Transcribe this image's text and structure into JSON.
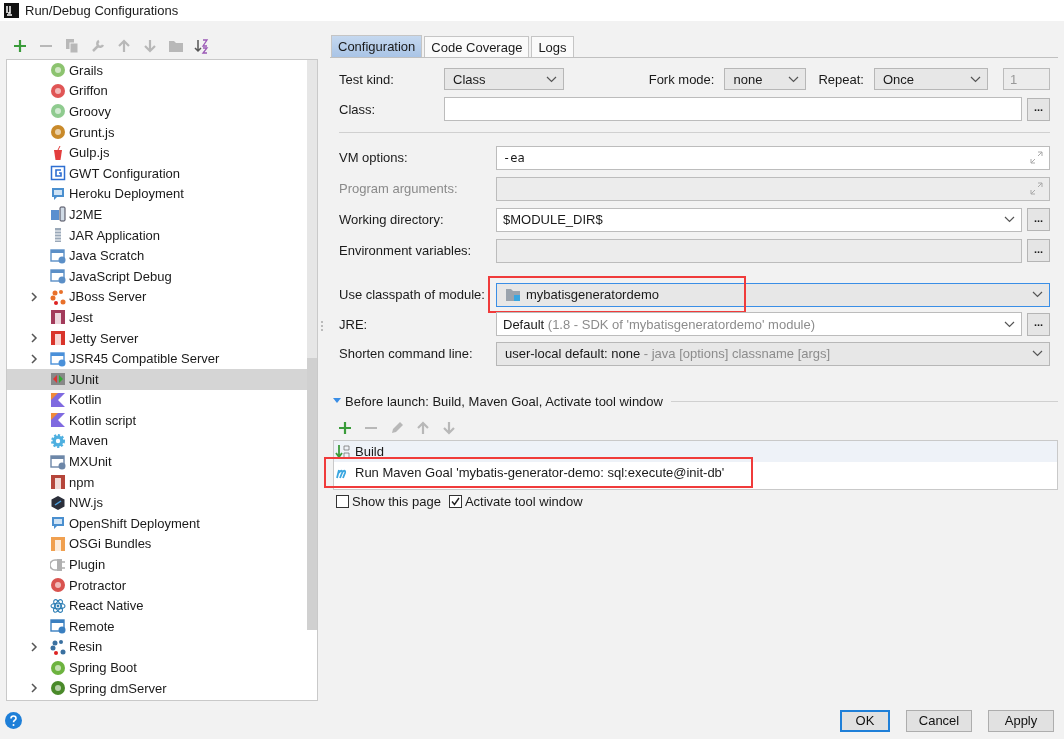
{
  "window": {
    "title": "Run/Debug Configurations"
  },
  "toolbar": [
    {
      "kind": "add",
      "disabled": false
    },
    {
      "kind": "remove",
      "disabled": true
    },
    {
      "kind": "copy",
      "disabled": true
    },
    {
      "kind": "wrench",
      "disabled": true
    },
    {
      "kind": "up",
      "disabled": true
    },
    {
      "kind": "down",
      "disabled": true
    },
    {
      "kind": "folder",
      "disabled": true
    },
    {
      "kind": "sort",
      "disabled": false
    }
  ],
  "tree": {
    "items": [
      {
        "label": "Grails",
        "kind": "disc",
        "color": "#8cc36f",
        "selected": false
      },
      {
        "label": "Griffon",
        "kind": "disc",
        "color": "#e05555",
        "selected": false
      },
      {
        "label": "Groovy",
        "kind": "disc",
        "color": "#8fcb8f",
        "selected": false
      },
      {
        "label": "Grunt.js",
        "kind": "disc",
        "color": "#c98a2a",
        "selected": false
      },
      {
        "label": "Gulp.js",
        "kind": "cup",
        "color": "#e33d3d",
        "selected": false
      },
      {
        "label": "GWT Configuration",
        "kind": "frame",
        "color": "#2f6fd1",
        "selected": false
      },
      {
        "label": "Heroku Deployment",
        "kind": "bubble",
        "color": "#4a8fcf",
        "selected": false
      },
      {
        "label": "J2ME",
        "kind": "phone",
        "color": "#5a8fcf",
        "selected": false
      },
      {
        "label": "JAR Application",
        "kind": "bars",
        "color": "#9aa8b8",
        "selected": false
      },
      {
        "label": "Java Scratch",
        "kind": "window",
        "color": "#5b8fc7",
        "selected": false
      },
      {
        "label": "JavaScript Debug",
        "kind": "window",
        "color": "#5b8fc7",
        "selected": false
      },
      {
        "label": "JBoss Server",
        "kind": "dots",
        "color": "#e8702a",
        "selected": false,
        "expanded": false
      },
      {
        "label": "Jest",
        "kind": "square",
        "color": "#a33b5b",
        "selected": false
      },
      {
        "label": "Jetty Server",
        "kind": "square",
        "color": "#d9342b",
        "selected": false,
        "expanded": false
      },
      {
        "label": "JSR45 Compatible Server",
        "kind": "window",
        "color": "#4a90d9",
        "selected": false,
        "expanded": false
      },
      {
        "label": "JUnit",
        "kind": "split",
        "color": "#888888",
        "selected": true
      },
      {
        "label": "Kotlin",
        "kind": "wedge",
        "color": "#7f6ae0",
        "selected": false
      },
      {
        "label": "Kotlin script",
        "kind": "wedge",
        "color": "#7f6ae0",
        "selected": false
      },
      {
        "label": "Maven",
        "kind": "gear",
        "color": "#4fb0e0",
        "selected": false
      },
      {
        "label": "MXUnit",
        "kind": "window",
        "color": "#6d87a8",
        "selected": false
      },
      {
        "label": "npm",
        "kind": "square",
        "color": "#b5453a",
        "selected": false
      },
      {
        "label": "NW.js",
        "kind": "hex",
        "color": "#2b2f3a",
        "selected": false
      },
      {
        "label": "OpenShift Deployment",
        "kind": "bubble",
        "color": "#4a8fcf",
        "selected": false
      },
      {
        "label": "OSGi Bundles",
        "kind": "square",
        "color": "#f0a050",
        "selected": false
      },
      {
        "label": "Plugin",
        "kind": "plug",
        "color": "#b0b0b0",
        "selected": false
      },
      {
        "label": "Protractor",
        "kind": "disc",
        "color": "#d9534f",
        "selected": false
      },
      {
        "label": "React Native",
        "kind": "atom",
        "color": "#2f7fb5",
        "selected": false
      },
      {
        "label": "Remote",
        "kind": "window",
        "color": "#3a7fc0",
        "selected": false
      },
      {
        "label": "Resin",
        "kind": "dots",
        "color": "#3a70a0",
        "selected": false,
        "expanded": false
      },
      {
        "label": "Spring Boot",
        "kind": "disc",
        "color": "#6db33f",
        "selected": false
      },
      {
        "label": "Spring dmServer",
        "kind": "disc",
        "color": "#4a8a2a",
        "selected": false,
        "expanded": false
      }
    ]
  },
  "tabs": [
    {
      "label": "Configuration",
      "selected": true
    },
    {
      "label": "Code Coverage",
      "selected": false
    },
    {
      "label": "Logs",
      "selected": false
    }
  ],
  "test_row": {
    "test_kind": {
      "label": "Test kind:",
      "value": "Class"
    },
    "fork_mode": {
      "label": "Fork mode:",
      "value": "none"
    },
    "repeat": {
      "label": "Repeat:",
      "value": "Once",
      "count": "1"
    }
  },
  "class_row": {
    "label": "Class:",
    "button": "..."
  },
  "fields": [
    {
      "label": "VM options:",
      "kind": "expand",
      "value": "-ea",
      "disabled": false
    },
    {
      "label": "Program arguments:",
      "kind": "expand",
      "disabled": true
    },
    {
      "label": "Working directory:",
      "kind": "combo-browse",
      "value": "$MODULE_DIR$",
      "button": "..."
    },
    {
      "label": "Environment variables:",
      "kind": "browse",
      "button": "..."
    },
    {
      "label": "Use classpath of module:",
      "kind": "module",
      "value": "mybatisgeneratordemo",
      "highlighted": true
    },
    {
      "label": "JRE:",
      "kind": "combo-browse",
      "value": "Default",
      "hint": "(1.8 - SDK of 'mybatisgeneratordemo' module)",
      "button": "..."
    },
    {
      "label": "Shorten command line:",
      "kind": "combo",
      "value": "user-local default: none",
      "hint": "- java [options] classname [args]"
    }
  ],
  "before_launch": {
    "title": "Before launch: Build, Maven Goal, Activate tool window",
    "expanded": true,
    "toolbar": [
      {
        "kind": "add",
        "disabled": false
      },
      {
        "kind": "remove",
        "disabled": true
      },
      {
        "kind": "edit",
        "disabled": true
      },
      {
        "kind": "up",
        "disabled": true
      },
      {
        "kind": "down",
        "disabled": true
      }
    ],
    "tasks": [
      {
        "label": "Build",
        "kind": "build",
        "selected": true,
        "highlighted": false
      },
      {
        "label": "Run Maven Goal 'mybatis-generator-demo: sql:execute@init-db'",
        "kind": "maven",
        "selected": false,
        "highlighted": true
      }
    ],
    "checkboxes": [
      {
        "label": "Show this page",
        "checked": false
      },
      {
        "label": "Activate tool window",
        "checked": true
      }
    ]
  },
  "buttons": [
    {
      "label": "OK",
      "default": true
    },
    {
      "label": "Cancel",
      "default": false
    },
    {
      "label": "Apply",
      "default": false
    }
  ]
}
